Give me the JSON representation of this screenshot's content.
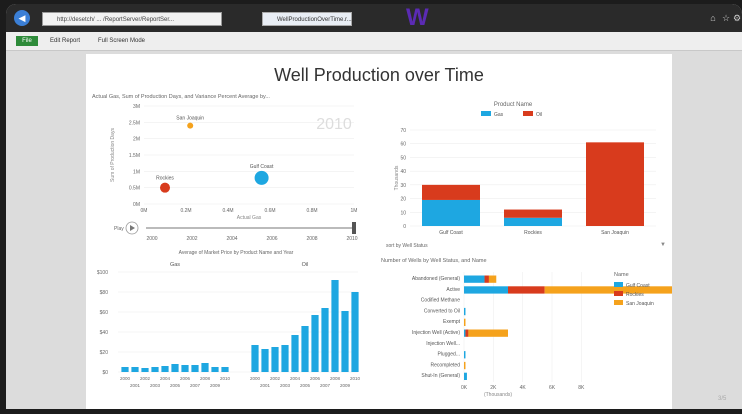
{
  "browser": {
    "address": "http://desetch/ ... /ReportServer/ReportSer...",
    "tab_title": "WellProductionOverTime.r...",
    "title_glyph": "W"
  },
  "toolbar": {
    "file_label": "File",
    "edit_report": "Edit Report",
    "full_screen": "Full Screen Mode"
  },
  "report": {
    "title": "Well Production over Time",
    "scatter_title": "Actual Gas, Sum of Production Days, and Variance Percent Average by...",
    "bar_title": "Product Name",
    "market_title": "Average of Market Price by Product Name and Year",
    "wells_title": "Number of Wells by Well Status, and Name",
    "sort_label": "sort by Well Status",
    "play_label": "Play",
    "page_indicator": "3/5"
  },
  "colors": {
    "gas": "#1ea7e1",
    "oil": "#d83b1d",
    "sanjoaquin": "#f5a21c",
    "title_text": "#333333"
  },
  "chart_data": [
    {
      "type": "scatter",
      "title": "Actual Gas, Sum of Production Days, and Variance Percent Average by...",
      "xlabel": "Actual Gas",
      "ylabel": "Sum of Production Days",
      "watermark": "2010",
      "xlim": [
        0,
        1000000
      ],
      "ylim": [
        0,
        3000000
      ],
      "x_ticks": [
        "0M",
        "0.2M",
        "0.4M",
        "0.6M",
        "0.8M",
        "1M"
      ],
      "x_tick_values": [
        0,
        200000,
        400000,
        600000,
        800000,
        1000000
      ],
      "y_ticks": [
        "0M",
        "0.5M",
        "1M",
        "1.5M",
        "2M",
        "2.5M",
        "3M"
      ],
      "y_tick_values": [
        0,
        500000,
        1000000,
        1500000,
        2000000,
        2500000,
        3000000
      ],
      "points": [
        {
          "label": "San Joaquin",
          "x": 220000,
          "y": 2400000,
          "color": "#f5a21c",
          "r": 3
        },
        {
          "label": "Gulf Coast",
          "x": 560000,
          "y": 800000,
          "color": "#1ea7e1",
          "r": 7
        },
        {
          "label": "Rockies",
          "x": 100000,
          "y": 500000,
          "color": "#d83b1d",
          "r": 5
        }
      ],
      "timeline": {
        "labels": [
          "2000",
          "2002",
          "2004",
          "2006",
          "2008",
          "2010"
        ],
        "current": "2010"
      }
    },
    {
      "type": "bar",
      "title": "Product Name",
      "stacked": true,
      "categories": [
        "Gulf Coast",
        "Rockies",
        "San Joaquin"
      ],
      "series": [
        {
          "name": "Gas",
          "values": [
            19,
            6,
            0
          ],
          "color": "#1ea7e1"
        },
        {
          "name": "Oil",
          "values": [
            11,
            6,
            61
          ],
          "color": "#d83b1d"
        }
      ],
      "ylabel": "Thousands",
      "ylim": [
        0,
        70
      ],
      "y_ticks": [
        "0",
        "10",
        "20",
        "30",
        "40",
        "50",
        "60",
        "70"
      ],
      "legend": "top"
    },
    {
      "type": "bar",
      "title": "Average of Market Price by Product Name and Year",
      "ylim": [
        0,
        100
      ],
      "y_ticks": [
        "$0",
        "$20",
        "$40",
        "$60",
        "$80",
        "$100"
      ],
      "panels": [
        {
          "name": "Gas",
          "categories": [
            "2000",
            "2001",
            "2002",
            "2003",
            "2004",
            "2005",
            "2006",
            "2007",
            "2008",
            "2009",
            "2010"
          ],
          "values": [
            5,
            5,
            4,
            5,
            6,
            8,
            7,
            7,
            9,
            5,
            5
          ]
        },
        {
          "name": "Oil",
          "categories": [
            "2000",
            "2001",
            "2002",
            "2003",
            "2004",
            "2005",
            "2006",
            "2007",
            "2008",
            "2009",
            "2010"
          ],
          "values": [
            27,
            23,
            25,
            27,
            37,
            46,
            57,
            64,
            92,
            61,
            80
          ]
        }
      ],
      "x_top": [
        "2000",
        "2002",
        "2004",
        "2006",
        "2008",
        "2010"
      ],
      "x_bottom": [
        "2001",
        "2003",
        "2005",
        "2007",
        "2009"
      ]
    },
    {
      "type": "bar",
      "orientation": "horizontal",
      "stacked": true,
      "title": "Number of Wells by Well Status, and Name",
      "categories": [
        "Abandoned (General)",
        "Active",
        "Codified Methane",
        "Converted to Oil",
        "Exempt",
        "Injection Well (Active)",
        "Injection Well...",
        "Plugged...",
        "Recompleted",
        "Shut-In (General)"
      ],
      "series": [
        {
          "name": "Gulf Coast",
          "values": [
            1400,
            3000,
            0,
            100,
            0,
            100,
            0,
            100,
            0,
            200
          ],
          "color": "#1ea7e1"
        },
        {
          "name": "Rockies",
          "values": [
            300,
            2500,
            0,
            0,
            0,
            200,
            0,
            0,
            0,
            0
          ],
          "color": "#d83b1d"
        },
        {
          "name": "San Joaquin",
          "values": [
            500,
            11000,
            0,
            0,
            100,
            2700,
            0,
            0,
            100,
            0
          ],
          "color": "#f5a21c"
        }
      ],
      "xlabel": "(Thousands)",
      "xlim": [
        0,
        9000
      ],
      "x_ticks": [
        "0K",
        "2K",
        "4K",
        "6K",
        "8K"
      ],
      "legend_title": "Name",
      "legend": "right"
    }
  ]
}
